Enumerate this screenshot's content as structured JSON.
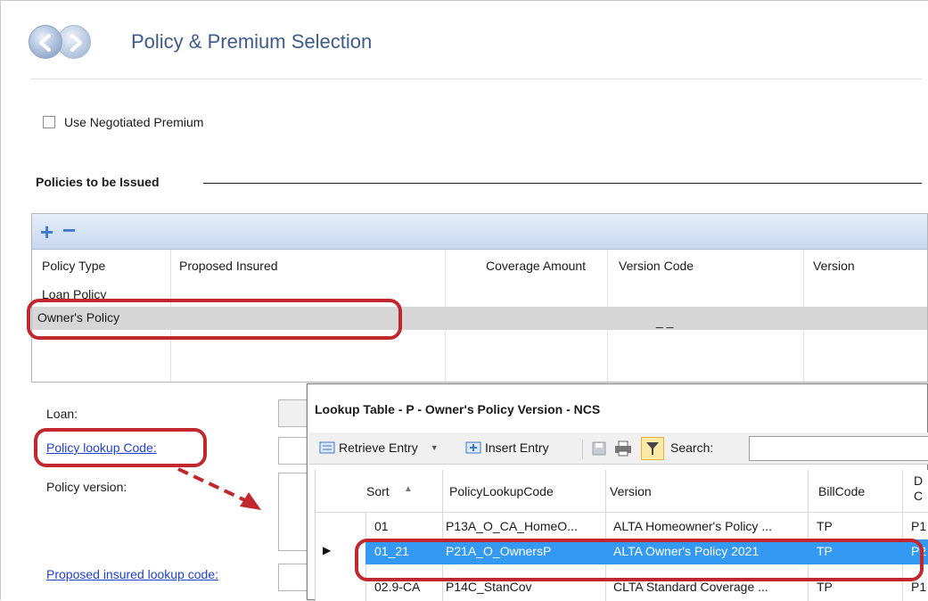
{
  "header": {
    "title": "Policy & Premium Selection"
  },
  "negotiated": {
    "label": "Use Negotiated Premium"
  },
  "section": {
    "title": "Policies to be Issued"
  },
  "grid": {
    "plus": "+",
    "minus": "−",
    "headers": [
      "Policy Type",
      "Proposed Insured",
      "Coverage Amount",
      "Version Code",
      "Version"
    ],
    "rows": [
      {
        "policy_type": "Loan Policy",
        "version_code": ""
      },
      {
        "policy_type": "Owner's Policy",
        "version_code": "_ _"
      }
    ]
  },
  "form": {
    "loan_label": "Loan:",
    "policy_lookup_link": "Policy lookup Code:",
    "policy_version_label": "Policy version:",
    "proposed_insured_link": "Proposed insured lookup code:"
  },
  "lookup": {
    "title": "Lookup Table - P - Owner's Policy Version - NCS",
    "toolbar": {
      "retrieve": "Retrieve Entry",
      "insert": "Insert Entry",
      "search": "Search:"
    },
    "headers": [
      "Sort",
      "PolicyLookupCode",
      "Version",
      "BillCode",
      "D\nC"
    ],
    "rows": [
      {
        "sort": "01",
        "code": "P13A_O_CA_HomeO...",
        "version": "ALTA Homeowner's Policy ...",
        "bill": "TP",
        "extra": "P1"
      },
      {
        "sort": "01_21",
        "code": "P21A_O_OwnersP",
        "version": "ALTA Owner's Policy 2021",
        "bill": "TP",
        "extra": "P2"
      },
      {
        "sort": "02.9-CA",
        "code": "P14C_StanCov",
        "version": "CLTA Standard Coverage ...",
        "bill": "TP",
        "extra": "P1"
      }
    ]
  },
  "colors": {
    "accent": "#3d5a8a",
    "highlight": "#c1272d",
    "selection": "#3399f3",
    "link": "#1f3fd1"
  }
}
